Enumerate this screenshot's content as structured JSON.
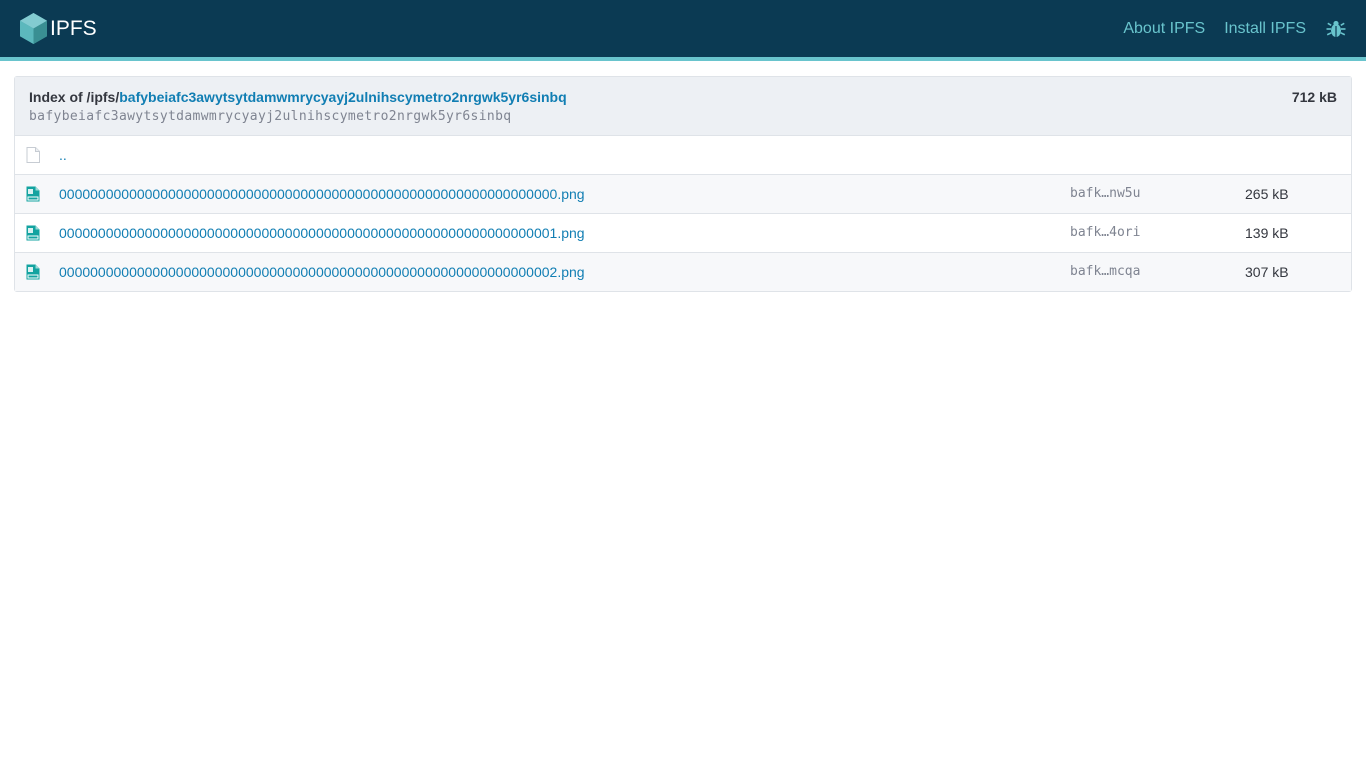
{
  "header": {
    "logo_text": "IPFS",
    "nav": [
      {
        "label": "About IPFS"
      },
      {
        "label": "Install IPFS"
      }
    ],
    "colors": {
      "bar": "#0b3a53",
      "accent": "#69c4cd"
    }
  },
  "index": {
    "prefix": "Index of /ipfs/",
    "cid_link": "bafybeiafc3awytsytdamwmrycyayj2ulnihscymetro2nrgwk5yr6sinbq",
    "cid_text": "bafybeiafc3awytsytdamwmrycyayj2ulnihscymetro2nrgwk5yr6sinbq",
    "total_size": "712 kB"
  },
  "parent": {
    "label": ".."
  },
  "files": [
    {
      "name": "0000000000000000000000000000000000000000000000000000000000000000.png",
      "cid": "bafk…nw5u",
      "size": "265 kB",
      "icon": "png-file-icon"
    },
    {
      "name": "0000000000000000000000000000000000000000000000000000000000000001.png",
      "cid": "bafk…4ori",
      "size": "139 kB",
      "icon": "png-file-icon"
    },
    {
      "name": "0000000000000000000000000000000000000000000000000000000000000002.png",
      "cid": "bafk…mcqa",
      "size": "307 kB",
      "icon": "png-file-icon"
    }
  ]
}
